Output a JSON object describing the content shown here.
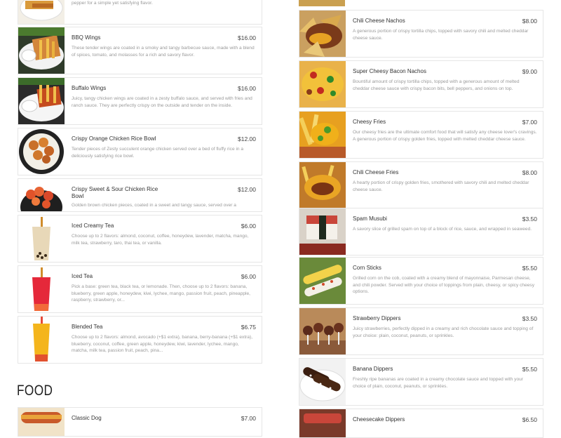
{
  "left": {
    "top_partial_desc": "pepper for a simple yet satisfying flavor.",
    "items": [
      {
        "name": "BBQ Wings",
        "price": "$16.00",
        "desc": "These tender wings are coated in a smoky and tangy barbecue sauce, made with a blend of spices, tomato, and molasses for a rich and savory flavor.",
        "icon": "bbq-wings-image"
      },
      {
        "name": "Buffalo Wings",
        "price": "$16.00",
        "desc": "Juicy, tangy chicken wings are coated in a zesty buffalo sauce, and served with fries and ranch sauce. They are perfectly crispy on the outside and tender on the inside.",
        "icon": "buffalo-wings-image"
      },
      {
        "name": "Crispy Orange Chicken Rice Bowl",
        "price": "$12.00",
        "desc": "Tender pieces of Zesty succulent orange chicken served over a bed of fluffy rice in a deliciously satisfying rice bowl.",
        "icon": "orange-chicken-bowl-image"
      },
      {
        "name": "Crispy Sweet & Sour Chicken Rice Bowl",
        "price": "$12.00",
        "desc": "Golden brown chicken pieces, coated in a sweet and tangy sauce, served over a",
        "icon": "sweet-sour-chicken-bowl-image"
      },
      {
        "name": "Iced Creamy Tea",
        "price": "$6.00",
        "desc": "Choose up to 2 flavors: almond, coconut, coffee, honeydew, lavender, matcha, mango, milk tea, strawberry, taro, thai tea, or vanilla.",
        "icon": "iced-creamy-tea-image"
      },
      {
        "name": "Iced Tea",
        "price": "$6.00",
        "desc": "Pick a base: green tea, black tea, or lemonade. Then, choose up to 2 flavors: banana, blueberry, green apple, honeydew, kiwi, lychee, mango, passion fruit, peach, pineapple, raspberry, strawberry, or...",
        "icon": "iced-tea-image"
      },
      {
        "name": "Blended Tea",
        "price": "$6.75",
        "desc": "Choose up to 2 flavors: almond, avocado (+$1 extra), banana, berry-banana (+$1 extra), blueberry, coconut, coffee, green apple, honeydew, kiwi, lavender, lychee, mango, matcha, milk tea, passion fruit, peach, pina...",
        "icon": "blended-tea-image"
      }
    ],
    "section_title": "FOOD",
    "food_items": [
      {
        "name": "Classic Dog",
        "price": "$7.00",
        "icon": "classic-dog-image"
      }
    ]
  },
  "right": {
    "items": [
      {
        "name": "Chili Cheese Nachos",
        "price": "$8.00",
        "desc": "A generous portion of crispy tortilla chips, topped with savory chili and melted cheddar cheese sauce.",
        "icon": "chili-cheese-nachos-image"
      },
      {
        "name": "Super Cheesy Bacon Nachos",
        "price": "$9.00",
        "desc": "Bountiful amount of crispy tortilla chips, topped with a generous amount of melted cheddar cheese sauce with crispy bacon bits, bell peppers, and onions on top.",
        "icon": "bacon-nachos-image"
      },
      {
        "name": "Cheesy Fries",
        "price": "$7.00",
        "desc": "Our cheesy fries are the ultimate comfort food that will satisfy any cheese lover's cravings. A generous portion of crispy golden fries, topped with melted cheddar cheese sauce.",
        "icon": "cheesy-fries-image"
      },
      {
        "name": "Chili Cheese Fries",
        "price": "$8.00",
        "desc": "A hearty portion of crispy golden fries, smothered with savory chili and melted cheddar cheese sauce.",
        "icon": "chili-cheese-fries-image"
      },
      {
        "name": "Spam Musubi",
        "price": "$3.50",
        "desc": "A savory slice of grilled spam on top of a block of rice, sauce, and wrapped in seaweed.",
        "icon": "spam-musubi-image"
      },
      {
        "name": "Corn Sticks",
        "price": "$5.50",
        "desc": "Grilled corn on the cob, coated with a creamy blend of mayonnaise, Parmesan cheese, and chili powder. Served with your choice of toppings from plain, cheesy, or spicy cheesy options.",
        "icon": "corn-sticks-image"
      },
      {
        "name": "Strawberry Dippers",
        "price": "$3.50",
        "desc": "Juicy strawberries, perfectly dipped in a creamy and rich chocolate sauce and topping of your choice: plain, coconut, peanuts, or sprinkles.",
        "icon": "strawberry-dippers-image"
      },
      {
        "name": "Banana Dippers",
        "price": "$5.50",
        "desc": "Freshly ripe bananas are coated in a creamy chocolate sauce and topped with your choice of plain, coconut, peanuts, or sprinkles.",
        "icon": "banana-dippers-image"
      },
      {
        "name": "Cheesecake Dippers",
        "price": "$6.50",
        "desc": "",
        "icon": "cheesecake-dippers-image"
      }
    ]
  }
}
